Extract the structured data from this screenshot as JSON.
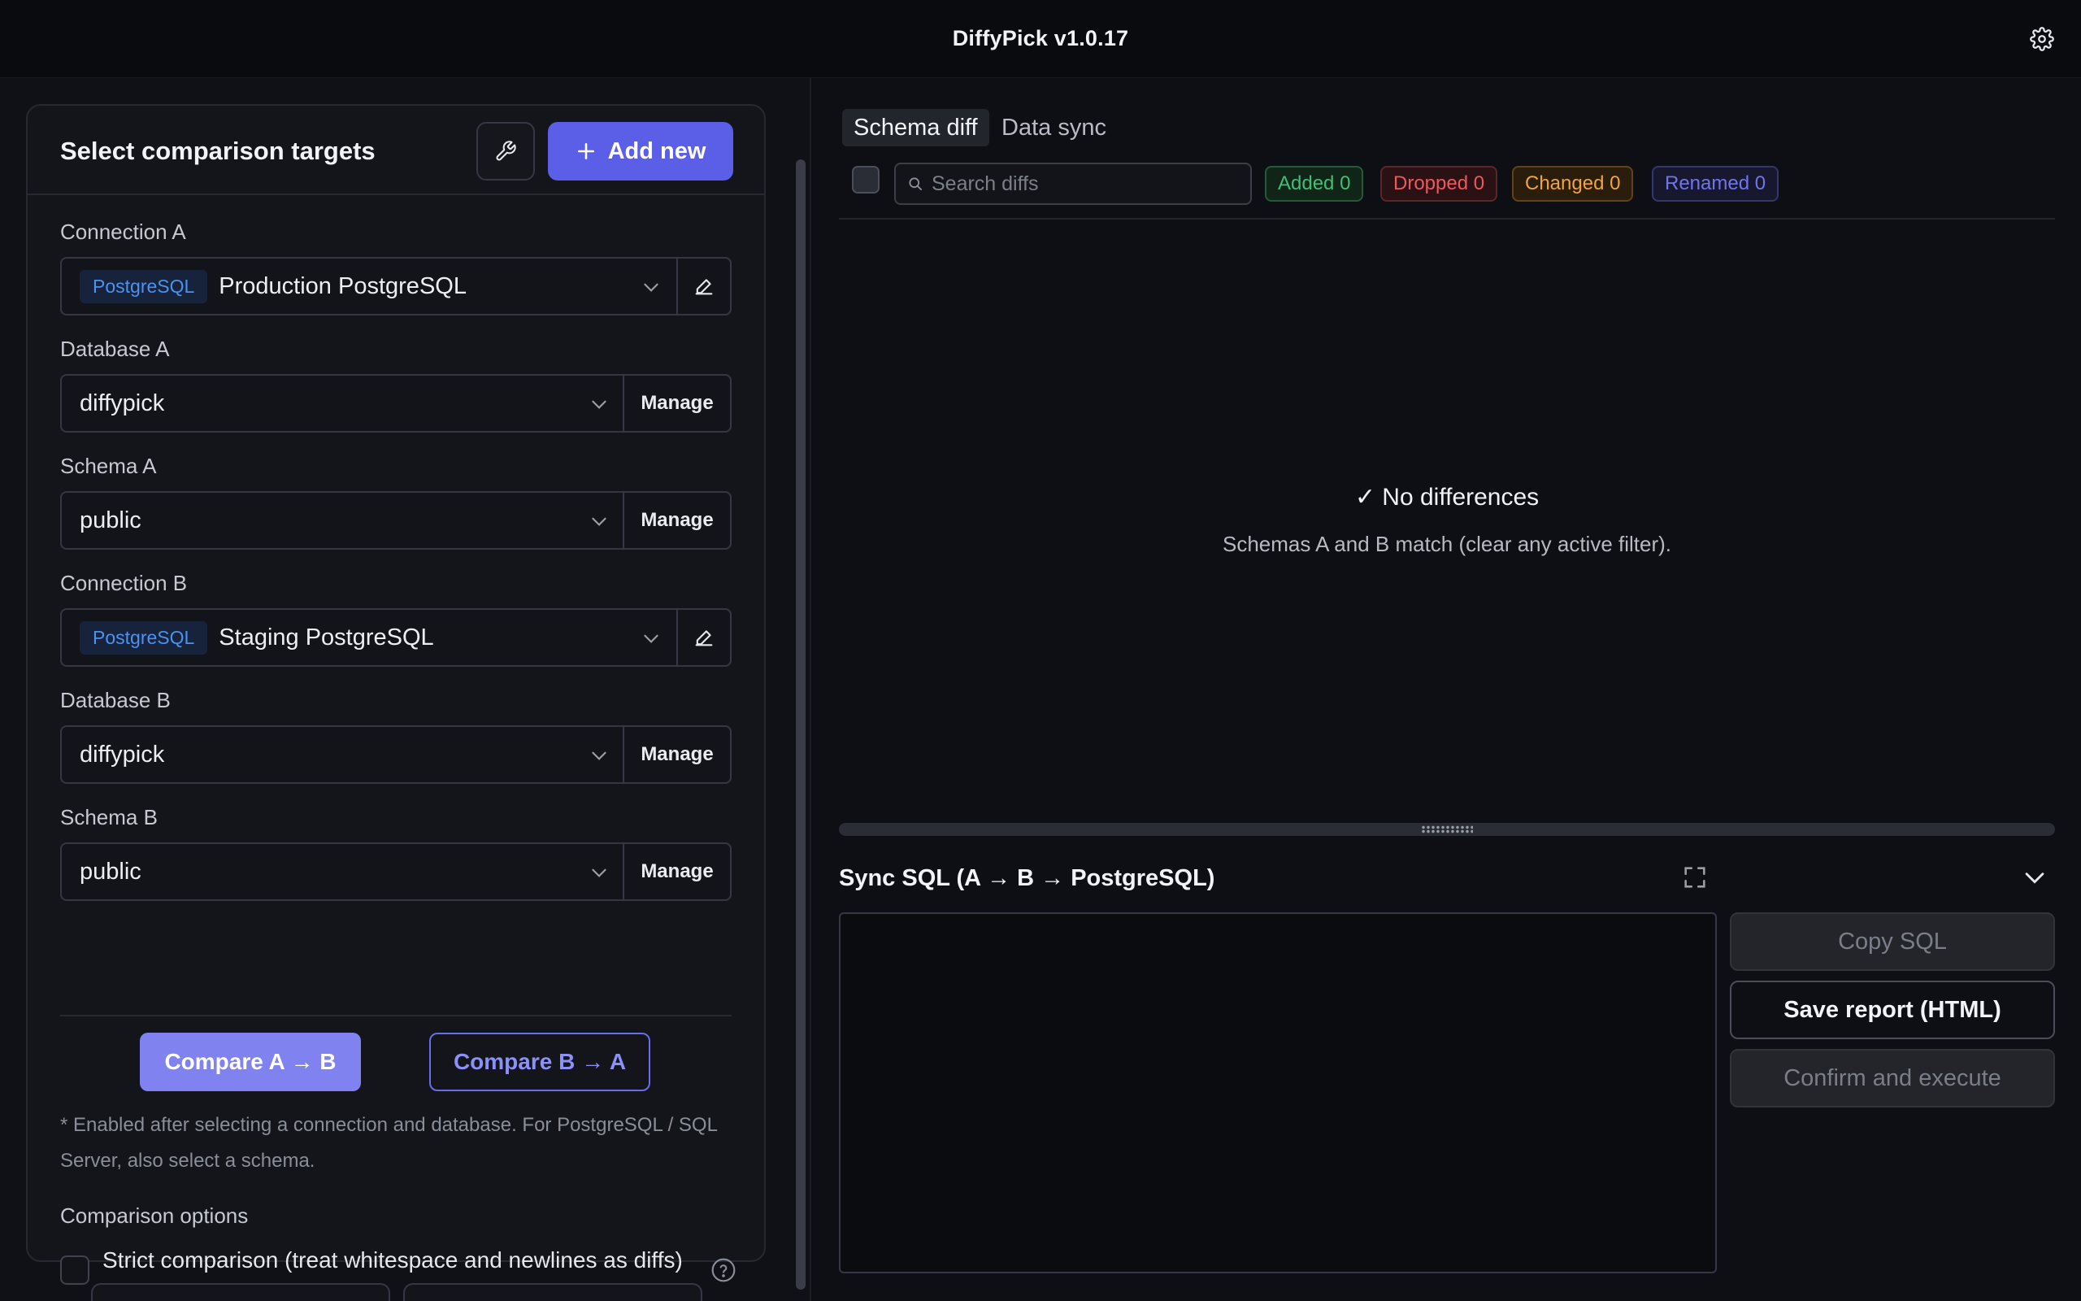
{
  "app": {
    "title": "DiffyPick v1.0.17"
  },
  "left": {
    "panel_title": "Select comparison targets",
    "add_new_label": "Add new",
    "connection_a": {
      "label": "Connection A",
      "engine": "PostgreSQL",
      "value": "Production PostgreSQL"
    },
    "database_a": {
      "label": "Database A",
      "value": "diffypick",
      "manage": "Manage"
    },
    "schema_a": {
      "label": "Schema A",
      "value": "public",
      "manage": "Manage"
    },
    "connection_b": {
      "label": "Connection B",
      "engine": "PostgreSQL",
      "value": "Staging PostgreSQL"
    },
    "database_b": {
      "label": "Database B",
      "value": "diffypick",
      "manage": "Manage"
    },
    "schema_b": {
      "label": "Schema B",
      "value": "public",
      "manage": "Manage"
    },
    "compare_ab": "Compare A → B",
    "compare_ba": "Compare B → A",
    "hint": "* Enabled after selecting a connection and database. For PostgreSQL / SQL Server, also select a schema.",
    "options_label": "Comparison options",
    "strict_label": "Strict comparison (treat whitespace and newlines as diffs)"
  },
  "right": {
    "tabs": [
      {
        "label": "Schema diff"
      },
      {
        "label": "Data sync"
      }
    ],
    "search": {
      "placeholder": "Search diffs",
      "value": ""
    },
    "badges": {
      "added": "Added 0",
      "dropped": "Dropped 0",
      "changed": "Changed 0",
      "renamed": "Renamed 0"
    },
    "empty": {
      "title": "✓ No differences",
      "subtitle": "Schemas A and B match (clear any active filter)."
    },
    "sql": {
      "title": "Sync SQL (A → B → PostgreSQL)",
      "copy": "Copy SQL",
      "save": "Save report (HTML)",
      "execute": "Confirm and execute"
    }
  },
  "colors": {
    "accent": "#5b5fe8",
    "added": "#3fbf73",
    "dropped": "#f0565d",
    "changed": "#f0a43a",
    "renamed": "#7175ec"
  }
}
